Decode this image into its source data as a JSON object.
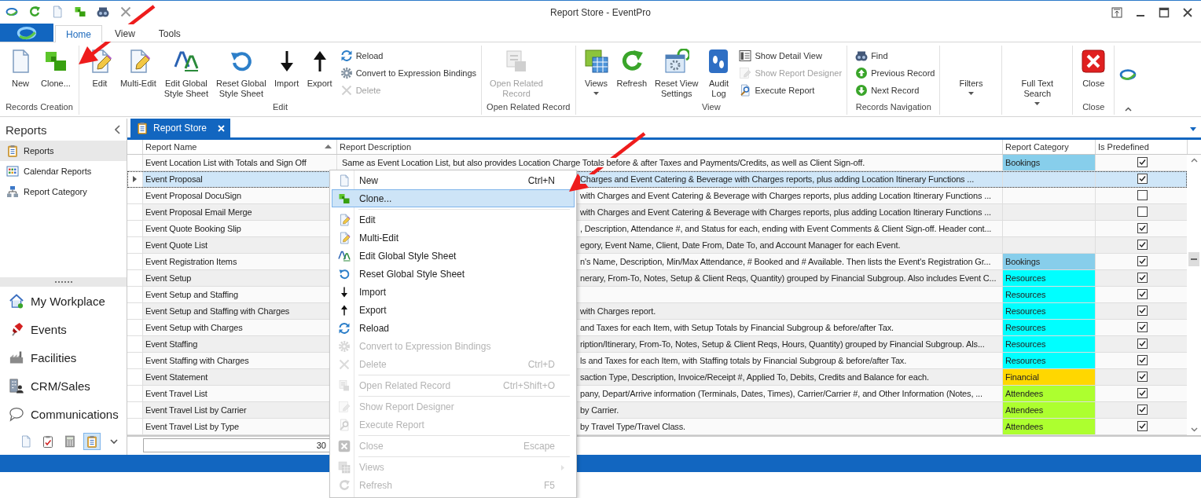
{
  "window": {
    "title": "Report Store - EventPro"
  },
  "ribbon_tabs": [
    {
      "label": "Home",
      "selected": true
    },
    {
      "label": "View",
      "selected": false
    },
    {
      "label": "Tools",
      "selected": false
    }
  ],
  "ribbon_groups": [
    {
      "label": "Records Creation",
      "items": [
        {
          "kind": "large",
          "label": "New",
          "disabled": false,
          "dropdown": false
        },
        {
          "kind": "large",
          "label": "Clone...",
          "disabled": false,
          "dropdown": false
        }
      ]
    },
    {
      "label": "Edit",
      "items": [
        {
          "kind": "large",
          "label": "Edit",
          "disabled": false,
          "dropdown": false
        },
        {
          "kind": "large",
          "label": "Multi-Edit",
          "disabled": false,
          "dropdown": false
        },
        {
          "kind": "large",
          "label": "Edit Global\nStyle Sheet",
          "disabled": false,
          "dropdown": false
        },
        {
          "kind": "large",
          "label": "Reset Global\nStyle Sheet",
          "disabled": false,
          "dropdown": false
        },
        {
          "kind": "large",
          "label": "Import",
          "disabled": false,
          "dropdown": false
        },
        {
          "kind": "large",
          "label": "Export",
          "disabled": false,
          "dropdown": false
        },
        {
          "kind": "small",
          "label": "Reload",
          "disabled": false,
          "dropdown": false
        },
        {
          "kind": "small",
          "label": "Convert to Expression Bindings",
          "disabled": false,
          "dropdown": false
        },
        {
          "kind": "small",
          "label": "Delete",
          "disabled": true,
          "dropdown": false
        }
      ]
    },
    {
      "label": "Open Related Record",
      "items": [
        {
          "kind": "large",
          "label": "Open Related\nRecord",
          "disabled": true,
          "dropdown": false
        }
      ]
    },
    {
      "label": "View",
      "items": [
        {
          "kind": "large",
          "label": "Views",
          "disabled": false,
          "dropdown": true
        },
        {
          "kind": "large",
          "label": "Refresh",
          "disabled": false,
          "dropdown": false
        },
        {
          "kind": "large",
          "label": "Reset View\nSettings",
          "disabled": false,
          "dropdown": false
        },
        {
          "kind": "large",
          "label": "Audit\nLog",
          "disabled": false,
          "dropdown": false
        },
        {
          "kind": "small",
          "label": "Show Detail View",
          "disabled": false,
          "dropdown": false
        },
        {
          "kind": "small",
          "label": "Show Report Designer",
          "disabled": true,
          "dropdown": false
        },
        {
          "kind": "small",
          "label": "Execute Report",
          "disabled": false,
          "dropdown": false
        }
      ]
    },
    {
      "label": "Records Navigation",
      "items": [
        {
          "kind": "small",
          "label": "Find",
          "disabled": false,
          "dropdown": false
        },
        {
          "kind": "small",
          "label": "Previous Record",
          "disabled": false,
          "dropdown": false
        },
        {
          "kind": "small",
          "label": "Next Record",
          "disabled": false,
          "dropdown": false
        }
      ]
    },
    {
      "items": [
        {
          "kind": "text",
          "label": "Filters",
          "disabled": false,
          "dropdown": true
        }
      ]
    },
    {
      "items": [
        {
          "kind": "text",
          "label": "Full Text\nSearch",
          "disabled": false,
          "dropdown": true
        }
      ]
    },
    {
      "label": "Close",
      "items": [
        {
          "kind": "large",
          "label": "Close",
          "disabled": false,
          "dropdown": false
        }
      ]
    }
  ],
  "sidebar": {
    "title": "Reports",
    "items": [
      {
        "label": "Reports",
        "selected": true
      },
      {
        "label": "Calendar Reports",
        "selected": false
      },
      {
        "label": "Report Category",
        "selected": false
      }
    ],
    "nav": [
      {
        "label": "My Workplace"
      },
      {
        "label": "Events"
      },
      {
        "label": "Facilities"
      },
      {
        "label": "CRM/Sales"
      },
      {
        "label": "Communications"
      }
    ],
    "shortcuts": [
      {
        "selected": false
      },
      {
        "selected": false
      },
      {
        "selected": false
      },
      {
        "selected": true
      }
    ]
  },
  "document_tab": {
    "label": "Report Store"
  },
  "grid": {
    "columns": [
      {
        "label": "Report Name",
        "sorted": true
      },
      {
        "label": "Report Description",
        "sorted": false
      },
      {
        "label": "Report Category",
        "sorted": false
      },
      {
        "label": "Is Predefined",
        "sorted": false
      }
    ],
    "rows": [
      {
        "name": "Event Location List with Totals and Sign Off",
        "description": "Same as Event Location List, but also provides Location Charge Totals before & after Taxes and Payments/Credits, as well as Client Sign-off.",
        "clipped": false,
        "category": "Bookings",
        "color": "#87ceeb",
        "predefined": true,
        "selected": false
      },
      {
        "name": "Event Proposal",
        "description": "Charges and Event Catering & Beverage with Charges reports, plus adding Location Itinerary Functions ...",
        "clipped": true,
        "predefined": true,
        "selected": true
      },
      {
        "name": "Event Proposal DocuSign",
        "description": "with Charges and Event Catering & Beverage with Charges reports, plus adding Location Itinerary Functions ...",
        "clipped": true,
        "predefined": false,
        "selected": false
      },
      {
        "name": "Event Proposal Email Merge",
        "description": "with Charges and Event Catering & Beverage with Charges reports, plus adding Location Itinerary Functions ...",
        "clipped": true,
        "predefined": false,
        "selected": false
      },
      {
        "name": "Event Quote Booking Slip",
        "description": ", Description, Attendance #, and Status for each, ending with Event Comments & Client Sign-off. Header cont...",
        "clipped": true,
        "predefined": true,
        "selected": false
      },
      {
        "name": "Event Quote List",
        "description": "egory, Event Name, Client, Date From, Date To, and Account Manager for each Event.",
        "clipped": true,
        "predefined": true,
        "selected": false
      },
      {
        "name": "Event Registration Items",
        "description": "n's Name, Description, Min/Max Attendance, # Booked and # Available. Then lists the Event's Registration Gr...",
        "clipped": true,
        "category": "Bookings",
        "color": "#87ceeb",
        "predefined": true,
        "selected": false
      },
      {
        "name": "Event Setup",
        "description": "nerary, From-To, Notes, Setup & Client Reqs, Quantity) grouped by Financial Subgroup. Also includes Event C...",
        "clipped": true,
        "category": "Resources",
        "color": "#00ffff",
        "predefined": true,
        "selected": false
      },
      {
        "name": "Event Setup and Staffing",
        "category": "Resources",
        "color": "#00ffff",
        "predefined": true,
        "selected": false
      },
      {
        "name": "Event Setup and Staffing with Charges",
        "description": "with Charges report.",
        "clipped": true,
        "category": "Resources",
        "color": "#00ffff",
        "predefined": true,
        "selected": false
      },
      {
        "name": "Event Setup with Charges",
        "description": "and Taxes for each Item, with Setup Totals by Financial Subgroup & before/after Tax.",
        "clipped": true,
        "category": "Resources",
        "color": "#00ffff",
        "predefined": true,
        "selected": false
      },
      {
        "name": "Event Staffing",
        "description": "ription/Itinerary, From-To, Notes, Setup & Client Reqs, Hours, Quantity) grouped by Financial Subgroup.  Als...",
        "clipped": true,
        "category": "Resources",
        "color": "#00ffff",
        "predefined": true,
        "selected": false
      },
      {
        "name": "Event Staffing with Charges",
        "description": "ls and Taxes for each Item, with Staffing totals by Financial Subgroup & before/after Tax.",
        "clipped": true,
        "category": "Resources",
        "color": "#00ffff",
        "predefined": true,
        "selected": false
      },
      {
        "name": "Event Statement",
        "description": "saction Type, Description, Invoice/Receipt #, Applied To, Debits, Credits and Balance for each.",
        "clipped": true,
        "category": "Financial",
        "color": "#ffd700",
        "predefined": true,
        "selected": false
      },
      {
        "name": "Event Travel List",
        "description": "pany, Depart/Arrive information (Terminals, Dates, Times), Carrier/Carrier #, and Other Information (Notes, ...",
        "clipped": true,
        "category": "Attendees",
        "color": "#adff2f",
        "predefined": true,
        "selected": false
      },
      {
        "name": "Event Travel List by Carrier",
        "description": "by Carrier.",
        "clipped": true,
        "category": "Attendees",
        "color": "#adff2f",
        "predefined": true,
        "selected": false
      },
      {
        "name": "Event Travel List by Type",
        "description": "by Travel Type/Travel Class.",
        "clipped": true,
        "category": "Attendees",
        "color": "#adff2f",
        "predefined": true,
        "selected": false
      }
    ],
    "footer": {
      "count": "30"
    }
  },
  "context_menu": {
    "items": [
      {
        "kind": "item",
        "label": "New",
        "shortcut": "Ctrl+N",
        "disabled": false,
        "selected": false,
        "submenu": false
      },
      {
        "kind": "item",
        "label": "Clone...",
        "disabled": false,
        "selected": true,
        "submenu": false
      },
      {
        "kind": "separator"
      },
      {
        "kind": "item",
        "label": "Edit",
        "disabled": false,
        "selected": false,
        "submenu": false
      },
      {
        "kind": "item",
        "label": "Multi-Edit",
        "disabled": false,
        "selected": false,
        "submenu": false
      },
      {
        "kind": "item",
        "label": "Edit Global Style Sheet",
        "disabled": false,
        "selected": false,
        "submenu": false
      },
      {
        "kind": "item",
        "label": "Reset Global Style Sheet",
        "disabled": false,
        "selected": false,
        "submenu": false
      },
      {
        "kind": "item",
        "label": "Import",
        "disabled": false,
        "selected": false,
        "submenu": false
      },
      {
        "kind": "item",
        "label": "Export",
        "disabled": false,
        "selected": false,
        "submenu": false
      },
      {
        "kind": "item",
        "label": "Reload",
        "disabled": false,
        "selected": false,
        "submenu": false
      },
      {
        "kind": "item",
        "label": "Convert to Expression Bindings",
        "disabled": true,
        "selected": false,
        "submenu": false
      },
      {
        "kind": "item",
        "label": "Delete",
        "shortcut": "Ctrl+D",
        "disabled": true,
        "selected": false,
        "submenu": false
      },
      {
        "kind": "separator"
      },
      {
        "kind": "item",
        "label": "Open Related Record",
        "shortcut": "Ctrl+Shift+O",
        "disabled": true,
        "selected": false,
        "submenu": false
      },
      {
        "kind": "separator"
      },
      {
        "kind": "item",
        "label": "Show Report Designer",
        "disabled": true,
        "selected": false,
        "submenu": false
      },
      {
        "kind": "item",
        "label": "Execute Report",
        "disabled": true,
        "selected": false,
        "submenu": false
      },
      {
        "kind": "separator"
      },
      {
        "kind": "item",
        "label": "Close",
        "shortcut": "Escape",
        "disabled": true,
        "selected": false,
        "submenu": false
      },
      {
        "kind": "separator"
      },
      {
        "kind": "item",
        "label": "Views",
        "disabled": true,
        "selected": false,
        "submenu": true
      },
      {
        "kind": "item",
        "label": "Refresh",
        "shortcut": "F5",
        "disabled": true,
        "selected": false,
        "submenu": false
      }
    ]
  }
}
